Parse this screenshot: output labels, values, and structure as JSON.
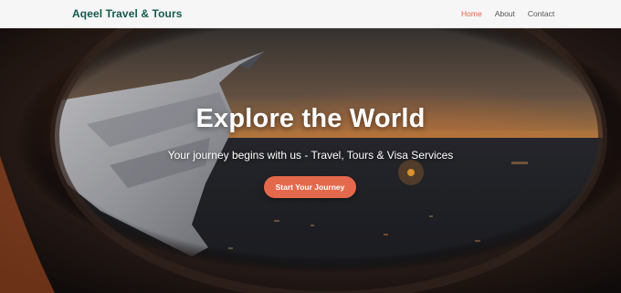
{
  "header": {
    "brand": "Aqeel Travel & Tours",
    "nav": [
      {
        "label": "Home",
        "active": true
      },
      {
        "label": "About",
        "active": false
      },
      {
        "label": "Contact",
        "active": false
      }
    ]
  },
  "hero": {
    "title": "Explore the World",
    "subtitle": "Your journey begins with us - Travel, Tours & Visa Services",
    "cta_label": "Start Your Journey"
  },
  "colors": {
    "brand": "#15594d",
    "accent": "#e4694c",
    "active_nav": "#e0664a"
  }
}
